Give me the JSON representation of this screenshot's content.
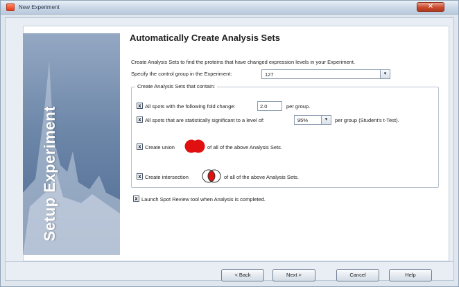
{
  "window": {
    "title": "New Experiment",
    "close_glyph": "✕",
    "icon": "app-icon"
  },
  "banner": {
    "text": "Setup Experiment"
  },
  "page": {
    "heading": "Automatically Create Analysis Sets",
    "description": "Create Analysis Sets to find the proteins that have changed expression levels in your Experiment.",
    "control_group_label": "Specify the control group in the Experiment:",
    "control_group_value": "127",
    "dropdown_arrow": "▾"
  },
  "group": {
    "title": "Create Analysis Sets that contain:",
    "fold_change": {
      "checked_glyph": "x",
      "label_before": "All spots with the following fold change:",
      "value": "2.0",
      "label_after": "per group."
    },
    "significance": {
      "checked_glyph": "x",
      "label_before": "All spots that are statistically significant to a level of:",
      "value": "95%",
      "label_after": "per group (Student's t-Test)."
    },
    "union": {
      "checked_glyph": "x",
      "label_before": "Create union",
      "label_after": "of all of the above Analysis Sets.",
      "icon": "union-venn-icon",
      "color": "#e01010"
    },
    "intersection": {
      "checked_glyph": "x",
      "label_before": "Create intersection",
      "label_after": "of all of the above Analysis Sets.",
      "icon": "intersection-venn-icon",
      "color": "#e01010"
    }
  },
  "launch": {
    "checked_glyph": "x",
    "label": "Launch Spot Review tool when Analysis is completed."
  },
  "buttons": {
    "back": "< Back",
    "next": "Next >",
    "cancel": "Cancel",
    "help": "Help"
  }
}
